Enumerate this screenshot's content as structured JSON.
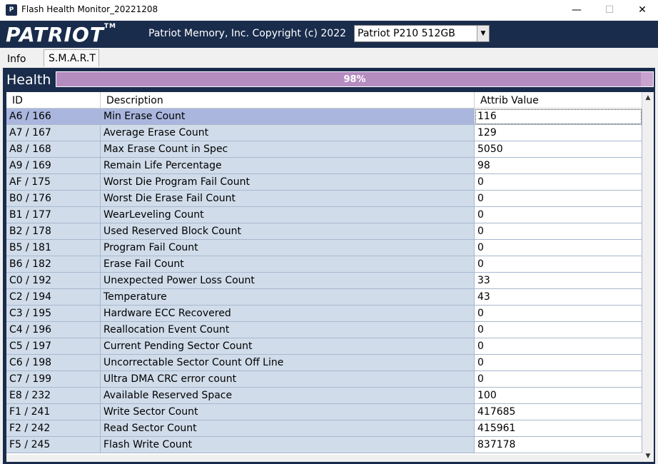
{
  "window": {
    "title": "Flash Health Monitor_20221208",
    "icon": "patriot-app-icon",
    "icon_text": "P",
    "minimize": "—",
    "maximize": "☐",
    "close": "✕"
  },
  "header": {
    "logo": "PATRIOT",
    "logo_tm": "TM",
    "copyright": "Patriot Memory, Inc. Copyright (c) 2022",
    "device": "Patriot P210 512GB",
    "device_arrow": "▼"
  },
  "tabs": [
    {
      "label": "Info",
      "active": false
    },
    {
      "label": "S.M.A.R.T",
      "active": true
    }
  ],
  "health": {
    "label": "Health",
    "percent": 98,
    "percent_text": "98%"
  },
  "table": {
    "columns": [
      "ID",
      "Description",
      "Attrib Value"
    ],
    "rows": [
      {
        "id": "A6 / 166",
        "desc": "Min Erase Count",
        "value": "116",
        "selected": true
      },
      {
        "id": "A7 / 167",
        "desc": "Average Erase Count",
        "value": "129"
      },
      {
        "id": "A8 / 168",
        "desc": "Max Erase Count in Spec",
        "value": "5050"
      },
      {
        "id": "A9 / 169",
        "desc": "Remain Life Percentage",
        "value": "98"
      },
      {
        "id": "AF / 175",
        "desc": "Worst Die Program Fail Count",
        "value": "0"
      },
      {
        "id": "B0 / 176",
        "desc": "Worst Die Erase Fail Count",
        "value": "0"
      },
      {
        "id": "B1 / 177",
        "desc": "WearLeveling Count",
        "value": "0"
      },
      {
        "id": "B2 / 178",
        "desc": "Used Reserved Block Count",
        "value": "0"
      },
      {
        "id": "B5 / 181",
        "desc": "Program Fail Count",
        "value": "0"
      },
      {
        "id": "B6 / 182",
        "desc": "Erase Fail Count",
        "value": "0"
      },
      {
        "id": "C0 / 192",
        "desc": "Unexpected Power Loss Count",
        "value": "33"
      },
      {
        "id": "C2 / 194",
        "desc": "Temperature",
        "value": "43"
      },
      {
        "id": "C3 / 195",
        "desc": "Hardware ECC Recovered",
        "value": "0"
      },
      {
        "id": "C4 / 196",
        "desc": "Reallocation Event Count",
        "value": "0"
      },
      {
        "id": "C5 / 197",
        "desc": "Current Pending Sector Count",
        "value": "0"
      },
      {
        "id": "C6 / 198",
        "desc": "Uncorrectable Sector Count Off Line",
        "value": "0"
      },
      {
        "id": "C7 / 199",
        "desc": "Ultra DMA CRC error count",
        "value": "0"
      },
      {
        "id": "E8 / 232",
        "desc": "Available Reserved Space",
        "value": "100"
      },
      {
        "id": "F1 / 241",
        "desc": "Write Sector Count",
        "value": "417685"
      },
      {
        "id": "F2 / 242",
        "desc": "Read Sector Count",
        "value": "415961"
      },
      {
        "id": "F5 / 245",
        "desc": "Flash Write Count",
        "value": "837178"
      }
    ]
  },
  "scrollbar": {
    "up": "▲",
    "down": "▼"
  },
  "colors": {
    "brand": "#1a2c4c",
    "health_bar": "#b48cc0",
    "row_bg": "#d0dcea",
    "row_selected": "#aab6de"
  }
}
